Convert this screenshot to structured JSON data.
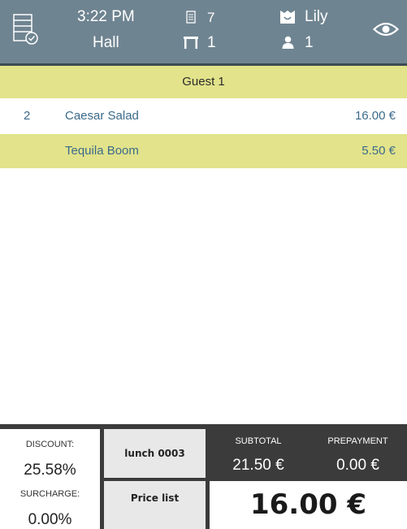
{
  "header": {
    "time": "3:22 PM",
    "location": "Hall",
    "order_number": "7",
    "table_number": "1",
    "waiter": "Lily",
    "guests": "1",
    "background_color": "#6f8491"
  },
  "guest_section": {
    "label": "Guest 1",
    "highlight_color": "#e2e38a"
  },
  "items": [
    {
      "qty": "2",
      "name": "Caesar Salad",
      "price": "16.00 €"
    },
    {
      "qty": "",
      "name": "Tequila Boom",
      "price": "5.50 €"
    }
  ],
  "footer": {
    "discount_label": "DISCOUNT:",
    "discount_value": "25.58%",
    "surcharge_label": "SURCHARGE:",
    "surcharge_value": "0.00%",
    "lunch_button": "lunch 0003",
    "price_list_button": "Price list",
    "subtotal_label": "SUBTOTAL",
    "subtotal_value": "21.50 €",
    "prepayment_label": "PREPAYMENT",
    "prepayment_value": "0.00 €",
    "total_value": "16.00 €"
  },
  "icons": {
    "tables": "tables-check-icon",
    "order": "order-receipt-icon",
    "table": "table-icon",
    "waiter": "waiter-icon",
    "guests": "person-icon",
    "view": "eye-icon"
  }
}
